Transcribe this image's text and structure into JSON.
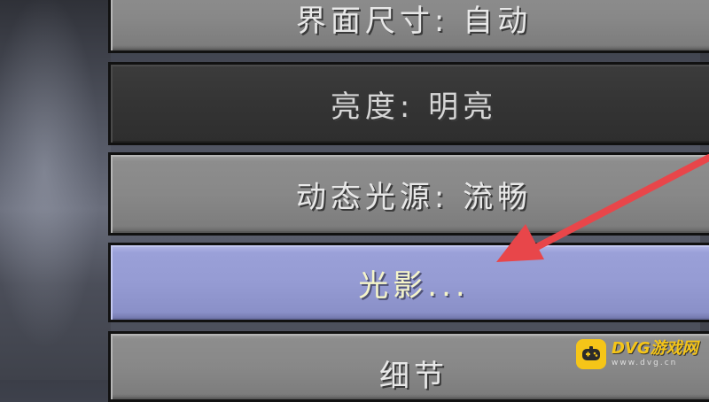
{
  "menu": {
    "gui_scale_label": "界面尺寸: 自动",
    "brightness_label": "亮度: 明亮",
    "dynamic_lights_label": "动态光源: 流畅",
    "shaders_label": "光影...",
    "details_label": "细节"
  },
  "annotation": {
    "arrow_color": "#e8464a",
    "points_to": "shaders_button"
  },
  "watermark": {
    "brand": "DVG游戏网",
    "url": "www.dvg.cn",
    "logo_color": "#f5c518"
  },
  "colors": {
    "button_gray": "#888888",
    "button_dark": "#343434",
    "button_hover": "#959bd3",
    "hover_text": "#f5f5c8"
  }
}
